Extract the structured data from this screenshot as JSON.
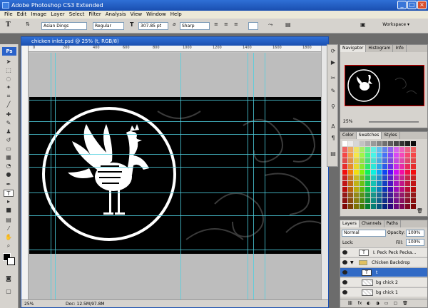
{
  "window": {
    "title": "Adobe Photoshop CS3 Extended"
  },
  "menu": [
    "File",
    "Edit",
    "Image",
    "Layer",
    "Select",
    "Filter",
    "Analysis",
    "View",
    "Window",
    "Help"
  ],
  "options": {
    "tool_icon": "T",
    "font_family": "Asian Dings",
    "font_style": "Regular",
    "font_size": "307.85 pt",
    "aa_icon": "a",
    "aa": "Sharp",
    "workspace": "Workspace"
  },
  "document": {
    "title": "chicken inlet.psd @ 25% (t, RGB/8)",
    "zoom": "25%",
    "doc_info": "Doc: 12.5M/97.8M",
    "ruler_labels": [
      "0",
      "200",
      "400",
      "600",
      "800",
      "1000",
      "1200",
      "1400",
      "1600",
      "1800"
    ]
  },
  "toolbox": {
    "logo": "Ps"
  },
  "navigator": {
    "tabs": [
      "Navigator",
      "Histogram",
      "Info"
    ],
    "zoom": "25%"
  },
  "color_panel": {
    "tabs": [
      "Color",
      "Swatches",
      "Styles"
    ]
  },
  "layers_panel": {
    "tabs": [
      "Layers",
      "Channels",
      "Paths"
    ],
    "blend_mode": "Normal",
    "opacity_label": "Opacity:",
    "opacity": "100%",
    "lock_label": "Lock:",
    "fill_label": "Fill:",
    "fill": "100%",
    "layers": [
      {
        "name": "I. Peck Peck Pecka...",
        "type": "text",
        "selected": false
      },
      {
        "name": "Chicken Backdrop",
        "type": "group",
        "selected": false
      },
      {
        "name": "t",
        "type": "text",
        "selected": true
      },
      {
        "name": "bg chick 2",
        "type": "pixel",
        "selected": false
      },
      {
        "name": "bg chick 1",
        "type": "pixel",
        "selected": false
      }
    ]
  },
  "colors": {
    "accent": "#316ac5",
    "guide": "#4ed0e0",
    "titlebar": "#1a4fb0"
  }
}
